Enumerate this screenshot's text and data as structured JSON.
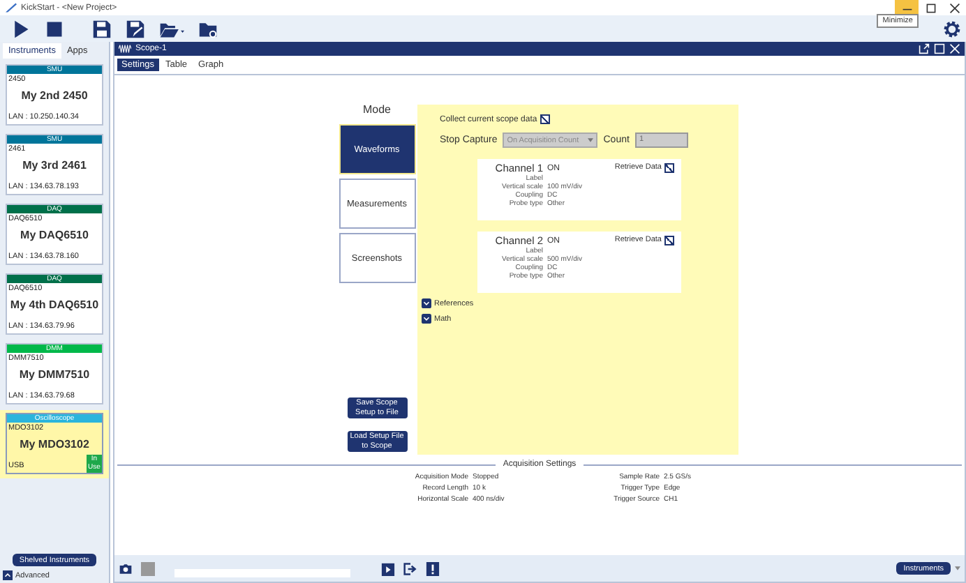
{
  "window": {
    "title": "KickStart - <New Project>",
    "tooltip": "Minimize"
  },
  "sidebar": {
    "tabs": [
      {
        "label": "Instruments",
        "selected": true
      },
      {
        "label": "Apps",
        "selected": false
      }
    ],
    "cards": [
      {
        "type": "SMU",
        "color": "#00759a",
        "model": "2450",
        "name": "My 2nd 2450",
        "connection": "LAN : 10.250.140.34",
        "selected": false,
        "in_use": false
      },
      {
        "type": "SMU",
        "color": "#00759a",
        "model": "2461",
        "name": "My 3rd 2461",
        "connection": "LAN : 134.63.78.193",
        "selected": false,
        "in_use": false
      },
      {
        "type": "DAQ",
        "color": "#00704a",
        "model": "DAQ6510",
        "name": "My DAQ6510",
        "connection": "LAN : 134.63.78.160",
        "selected": false,
        "in_use": false
      },
      {
        "type": "DAQ",
        "color": "#00704a",
        "model": "DAQ6510",
        "name": "My 4th DAQ6510",
        "connection": "LAN : 134.63.79.96",
        "selected": false,
        "in_use": false
      },
      {
        "type": "DMM",
        "color": "#00b84a",
        "model": "DMM7510",
        "name": "My DMM7510",
        "connection": "LAN : 134.63.79.68",
        "selected": false,
        "in_use": false
      },
      {
        "type": "Oscilloscope",
        "color": "#2bb5dc",
        "model": "MDO3102",
        "name": "My MDO3102",
        "connection": "USB",
        "selected": true,
        "in_use": true,
        "badge": "In Use"
      }
    ],
    "shelved_button": "Shelved Instruments",
    "advanced": "Advanced"
  },
  "panel": {
    "title": "Scope-1",
    "tabs": [
      {
        "label": "Settings",
        "selected": true
      },
      {
        "label": "Table",
        "selected": false
      },
      {
        "label": "Graph",
        "selected": false
      }
    ],
    "mode": {
      "label": "Mode",
      "buttons": [
        {
          "label": "Waveforms",
          "selected": true
        },
        {
          "label": "Measurements",
          "selected": false
        },
        {
          "label": "Screenshots",
          "selected": false
        }
      ]
    },
    "file_buttons": [
      "Save Scope Setup to File",
      "Load Setup File to Scope"
    ],
    "collect": {
      "label": "Collect current scope data",
      "checked": true
    },
    "stop_capture": {
      "label": "Stop Capture",
      "value": "On Acquisition Count",
      "disabled": true
    },
    "count": {
      "label": "Count",
      "value": "1",
      "disabled": true
    },
    "channels": [
      {
        "name": "Channel 1",
        "state": "ON",
        "retrieve_label": "Retrieve Data",
        "retrieve": true,
        "fields": [
          {
            "label": "Label"
          },
          {
            "label": "Vertical scale",
            "value": "100 mV/div"
          },
          {
            "label": "Coupling",
            "value": "DC"
          },
          {
            "label": "Probe type",
            "value": "Other"
          }
        ]
      },
      {
        "name": "Channel 2",
        "state": "ON",
        "retrieve_label": "Retrieve Data",
        "retrieve": true,
        "fields": [
          {
            "label": "Label"
          },
          {
            "label": "Vertical scale",
            "value": "500 mV/div"
          },
          {
            "label": "Coupling",
            "value": "DC"
          },
          {
            "label": "Probe type",
            "value": "Other"
          }
        ]
      }
    ],
    "sections": [
      {
        "label": "References",
        "expanded": false
      },
      {
        "label": "Math",
        "expanded": false
      }
    ],
    "acquisition": {
      "title": "Acquisition Settings",
      "left": [
        {
          "label": "Acquisition Mode",
          "value": "Stopped"
        },
        {
          "label": "Record Length",
          "value": "10 k"
        },
        {
          "label": "Horizontal Scale",
          "value": "400 ns/div"
        }
      ],
      "right": [
        {
          "label": "Sample Rate",
          "value": "2.5 GS/s"
        },
        {
          "label": "Trigger Type",
          "value": "Edge"
        },
        {
          "label": "Trigger Source",
          "value": "CH1"
        }
      ]
    },
    "bottom_button": "Instruments"
  }
}
